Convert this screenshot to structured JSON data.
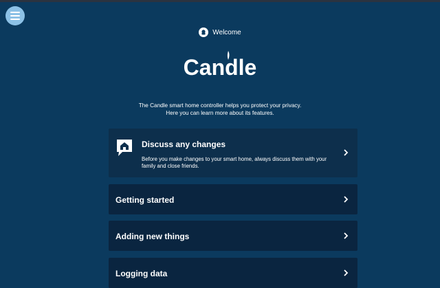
{
  "header": {
    "welcome_label": "Welcome"
  },
  "logo": {
    "text": "Candle"
  },
  "intro": {
    "line1": "The Candle smart home controller helps you protect your privacy.",
    "line2": "Here you can learn more about its features."
  },
  "cards": [
    {
      "title": "Discuss any changes",
      "description": "Before you make changes to your smart home, always discuss them with your family and close friends.",
      "icon": "house-speech-icon"
    },
    {
      "title": "Getting started"
    },
    {
      "title": "Adding new things"
    },
    {
      "title": "Logging data"
    }
  ],
  "colors": {
    "background": "#0b3a5e",
    "card": "#0a2540",
    "card_highlight": "#0d2f4c",
    "menu_button": "#8cc1e6"
  }
}
